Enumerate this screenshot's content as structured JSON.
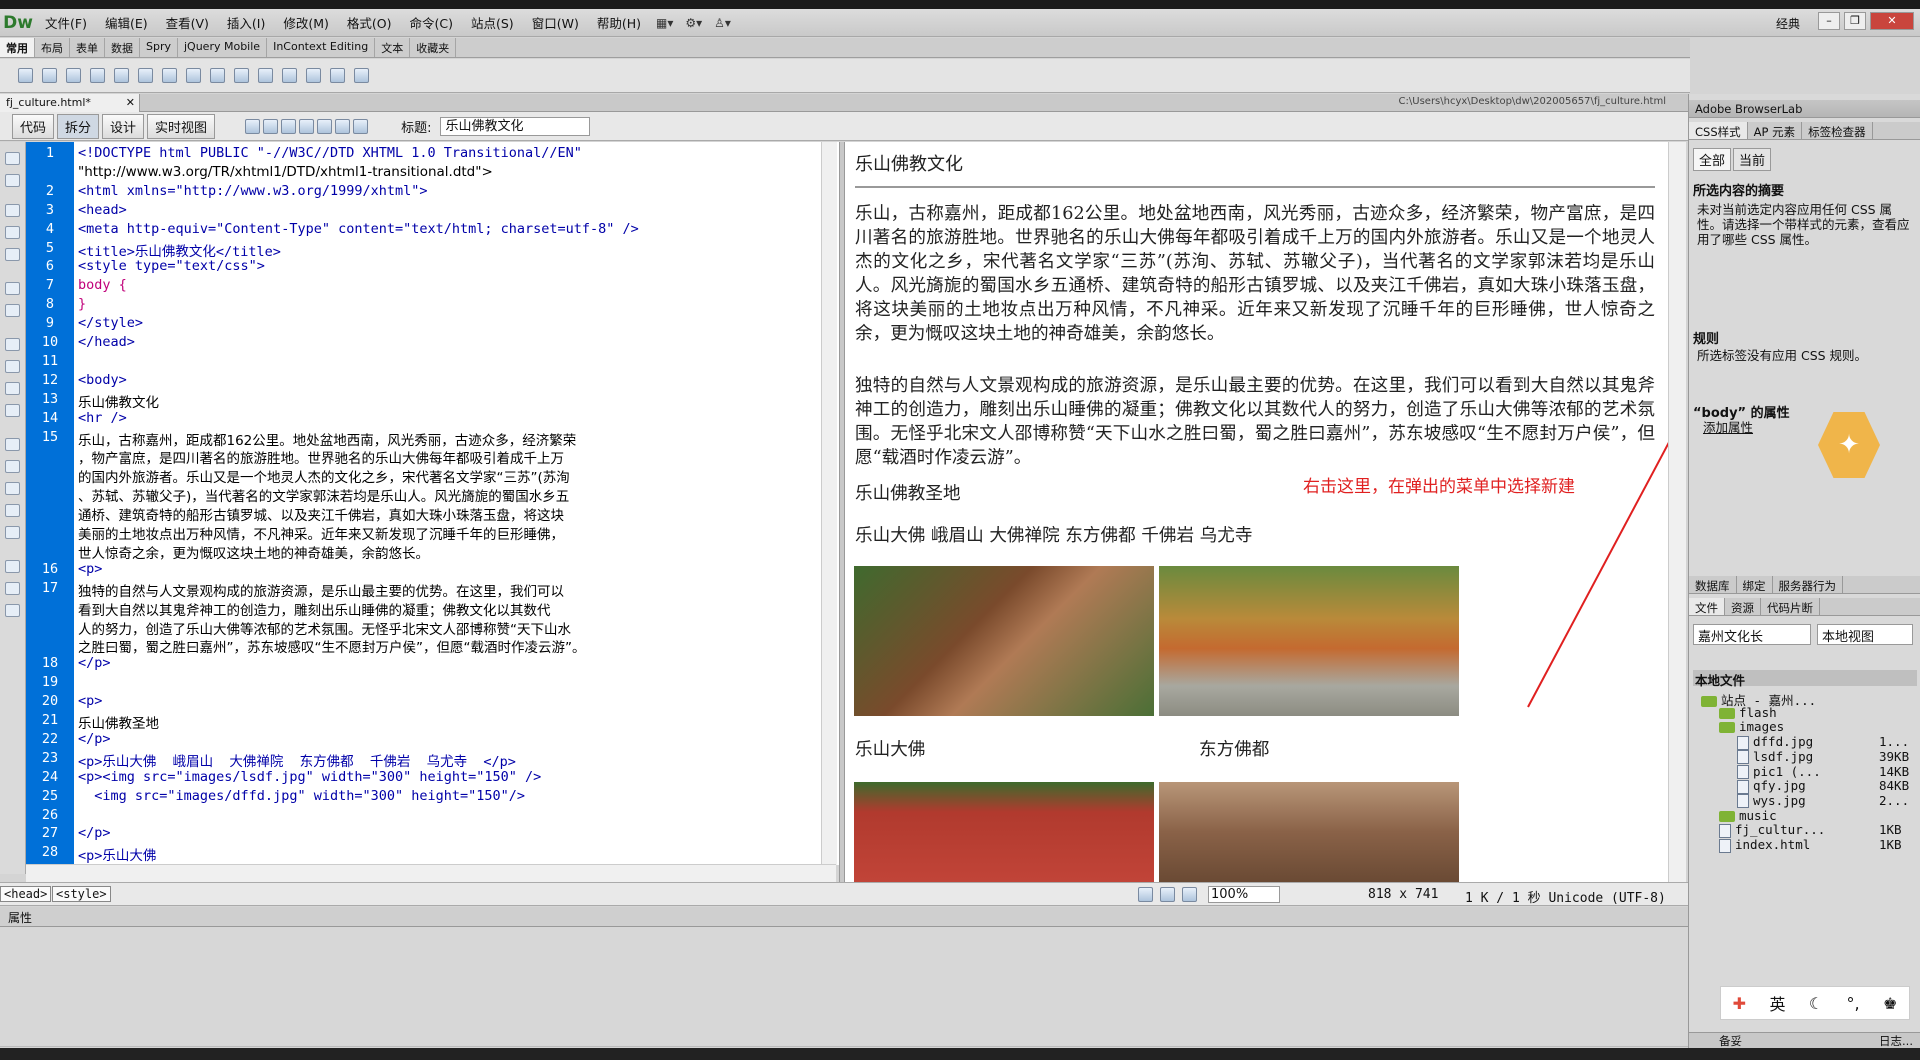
{
  "menubar": {
    "logo": "Dw",
    "items": [
      "文件(F)",
      "编辑(E)",
      "查看(V)",
      "插入(I)",
      "修改(M)",
      "格式(O)",
      "命令(C)",
      "站点(S)",
      "窗口(W)",
      "帮助(H)"
    ],
    "workspace": "经典"
  },
  "insert_tabs": [
    "常用",
    "布局",
    "表单",
    "数据",
    "Spry",
    "jQuery Mobile",
    "InContext Editing",
    "文本",
    "收藏夹"
  ],
  "doc": {
    "tab": "fj_culture.html*",
    "path": "C:\\Users\\hcyx\\Desktop\\dw\\202005657\\fj_culture.html"
  },
  "doctoolbar": {
    "views": [
      "代码",
      "拆分",
      "设计",
      "实时视图"
    ],
    "title_label": "标题:",
    "title_value": "乐山佛教文化"
  },
  "code_lines": [
    {
      "n": "1",
      "t": "<!DOCTYPE html PUBLIC \"-//W3C//DTD XHTML 1.0 Transitional//EN\""
    },
    {
      "n": "",
      "t": "\"http://www.w3.org/TR/xhtml1/DTD/xhtml1-transitional.dtd\">"
    },
    {
      "n": "2",
      "t": "<html xmlns=\"http://www.w3.org/1999/xhtml\">"
    },
    {
      "n": "3",
      "t": "<head>"
    },
    {
      "n": "4",
      "t": "<meta http-equiv=\"Content-Type\" content=\"text/html; charset=utf-8\" />"
    },
    {
      "n": "5",
      "t": "<title>乐山佛教文化</title>"
    },
    {
      "n": "6",
      "t": "<style type=\"text/css\">"
    },
    {
      "n": "7",
      "t": "body {"
    },
    {
      "n": "8",
      "t": "}"
    },
    {
      "n": "9",
      "t": "</style>"
    },
    {
      "n": "10",
      "t": "</head>"
    },
    {
      "n": "11",
      "t": ""
    },
    {
      "n": "12",
      "t": "<body>"
    },
    {
      "n": "13",
      "t": "乐山佛教文化"
    },
    {
      "n": "14",
      "t": "<hr />"
    },
    {
      "n": "15",
      "t": "乐山，古称嘉州，距成都162公里。地处盆地西南，风光秀丽，古迹众多，经济繁荣"
    },
    {
      "n": "",
      "t": "，物产富庶，是四川著名的旅游胜地。世界驰名的乐山大佛每年都吸引着成千上万"
    },
    {
      "n": "",
      "t": "的国内外旅游者。乐山又是一个地灵人杰的文化之乡，宋代著名文学家“三苏”(苏洵"
    },
    {
      "n": "",
      "t": "、苏轼、苏辙父子)，当代著名的文学家郭沫若均是乐山人。风光旖旎的蜀国水乡五"
    },
    {
      "n": "",
      "t": "通桥、建筑奇特的船形古镇罗城、以及夹江千佛岩，真如大珠小珠落玉盘，将这块"
    },
    {
      "n": "",
      "t": "美丽的土地妆点出万种风情，不凡神采。近年来又新发现了沉睡千年的巨形睡佛，"
    },
    {
      "n": "",
      "t": "世人惊奇之余，更为慨叹这块土地的神奇雄美，余韵悠长。"
    },
    {
      "n": "16",
      "t": "<p>"
    },
    {
      "n": "17",
      "t": "独特的自然与人文景观构成的旅游资源，是乐山最主要的优势。在这里，我们可以"
    },
    {
      "n": "",
      "t": "看到大自然以其鬼斧神工的创造力，雕刻出乐山睡佛的凝重；佛教文化以其数代"
    },
    {
      "n": "",
      "t": "人的努力，创造了乐山大佛等浓郁的艺术氛围。无怪乎北宋文人邵博称赞“天下山水"
    },
    {
      "n": "",
      "t": "之胜曰蜀，蜀之胜曰嘉州”，苏东坡感叹“生不愿封万户侯”，但愿“载酒时作凌云游”。"
    },
    {
      "n": "18",
      "t": "</p>"
    },
    {
      "n": "19",
      "t": ""
    },
    {
      "n": "20",
      "t": "<p>"
    },
    {
      "n": "21",
      "t": "乐山佛教圣地"
    },
    {
      "n": "22",
      "t": "</p>"
    },
    {
      "n": "23",
      "t": "<p>乐山大佛  峨眉山  大佛禅院  东方佛都  千佛岩  乌尤寺  </p>"
    },
    {
      "n": "24",
      "t": "<p><img src=\"images/lsdf.jpg\" width=\"300\" height=\"150\" />"
    },
    {
      "n": "25",
      "t": "  <img src=\"images/dffd.jpg\" width=\"300\" height=\"150\"/>"
    },
    {
      "n": "26",
      "t": ""
    },
    {
      "n": "27",
      "t": "</p>"
    },
    {
      "n": "28",
      "t": "<p>乐山大佛"
    }
  ],
  "design": {
    "title": "乐山佛教文化",
    "p1": "乐山，古称嘉州，距成都162公里。地处盆地西南，风光秀丽，古迹众多，经济繁荣，物产富庶，是四川著名的旅游胜地。世界驰名的乐山大佛每年都吸引着成千上万的国内外旅游者。乐山又是一个地灵人杰的文化之乡，宋代著名文学家“三苏”(苏洵、苏轼、苏辙父子)，当代著名的文学家郭沫若均是乐山人。风光旖旎的蜀国水乡五通桥、建筑奇特的船形古镇罗城、以及夹江千佛岩，真如大珠小珠落玉盘，将这块美丽的土地妆点出万种风情，不凡神采。近年来又新发现了沉睡千年的巨形睡佛，世人惊奇之余，更为慨叹这块土地的神奇雄美，余韵悠长。",
    "p2": "独特的自然与人文景观构成的旅游资源，是乐山最主要的优势。在这里，我们可以看到大自然以其鬼斧神工的创造力，雕刻出乐山睡佛的凝重；佛教文化以其数代人的努力，创造了乐山大佛等浓郁的艺术氛围。无怪乎北宋文人邵博称赞“天下山水之胜曰蜀，蜀之胜曰嘉州”，苏东坡感叹“生不愿封万户侯”，但愿“载酒时作凌云游”。",
    "holy": "乐山佛教圣地",
    "places": "乐山大佛 峨眉山 大佛禅院 东方佛都 千佛岩 乌尤寺",
    "cap1": "乐山大佛",
    "cap2": "东方佛都",
    "note": "右击这里，在弹出的菜单中选择新建"
  },
  "status": {
    "crumbs": [
      "<head>",
      "<style>"
    ],
    "zoom": "100%",
    "size": "818 x 741",
    "info": "1 K / 1 秒 Unicode (UTF-8)"
  },
  "properties_label": "属性",
  "right": {
    "browserlab": "Adobe BrowserLab",
    "css_tabs": [
      "CSS样式",
      "AP 元素",
      "标签检查器"
    ],
    "all_btn": "全部",
    "current_btn": "当前",
    "summary_head": "所选内容的摘要",
    "summary_text": "未对当前选定内容应用任何 CSS 属性。请选择一个带样式的元素，查看应用了哪些 CSS 属性。",
    "rules_head": "规则",
    "rules_text": "所选标签没有应用 CSS 规则。",
    "props_head": "“body” 的属性",
    "add_prop": "添加属性",
    "files_tabs1": [
      "数据库",
      "绑定",
      "服务器行为"
    ],
    "files_tabs2": [
      "文件",
      "资源",
      "代码片断"
    ],
    "site_select": "嘉州文化长",
    "view_select": "本地视图",
    "local_files": "本地文件",
    "tree": [
      {
        "name": "站点 - 嘉州...",
        "size": "",
        "kind": "folder",
        "indent": 0
      },
      {
        "name": "flash",
        "size": "",
        "kind": "folder",
        "indent": 1
      },
      {
        "name": "images",
        "size": "",
        "kind": "folder",
        "indent": 1
      },
      {
        "name": "dffd.jpg",
        "size": "1...",
        "kind": "file",
        "indent": 2
      },
      {
        "name": "lsdf.jpg",
        "size": "39KB",
        "kind": "file",
        "indent": 2
      },
      {
        "name": "pic1 (...",
        "size": "14KB",
        "kind": "file",
        "indent": 2
      },
      {
        "name": "qfy.jpg",
        "size": "84KB",
        "kind": "file",
        "indent": 2
      },
      {
        "name": "wys.jpg",
        "size": "2...",
        "kind": "file",
        "indent": 2
      },
      {
        "name": "music",
        "size": "",
        "kind": "folder",
        "indent": 1
      },
      {
        "name": "fj_cultur...",
        "size": "1KB",
        "kind": "file",
        "indent": 1
      },
      {
        "name": "index.html",
        "size": "1KB",
        "kind": "file",
        "indent": 1
      }
    ],
    "footer_left": "备妥",
    "footer_right": "日志..."
  },
  "ime": {
    "lang": "英"
  },
  "colors": {
    "gutter": "#0070d8",
    "tag": "#0000a8",
    "css": "#c0007a",
    "note": "#e02020"
  }
}
